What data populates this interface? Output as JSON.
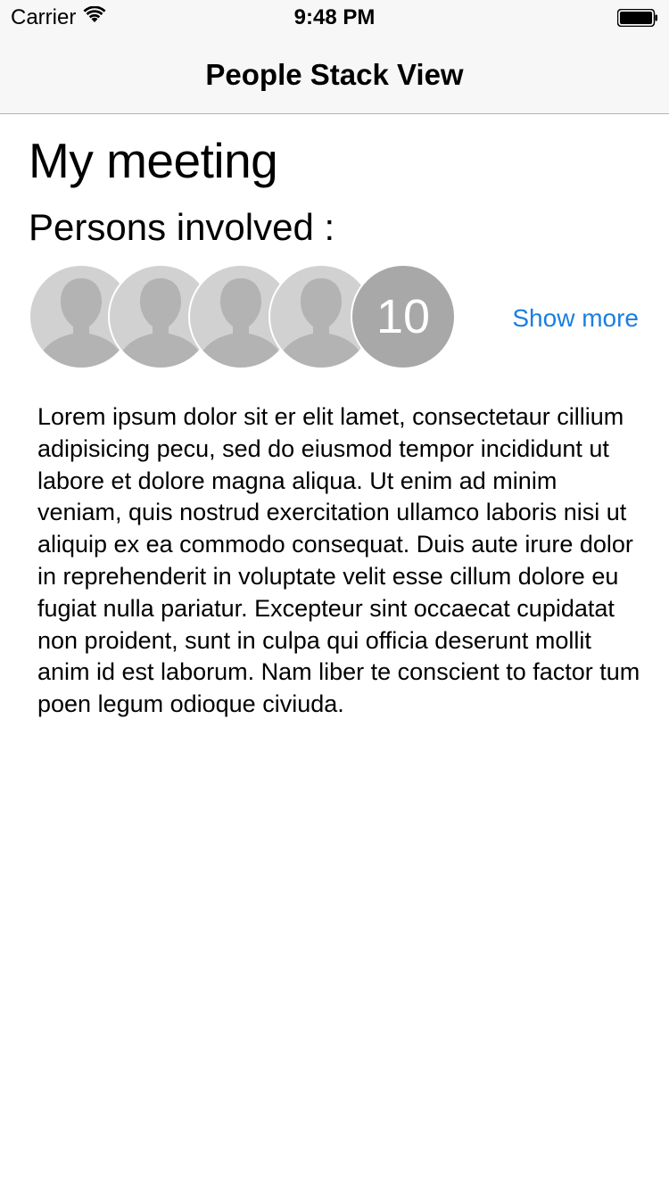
{
  "status_bar": {
    "carrier": "Carrier",
    "time": "9:48 PM",
    "icons": [
      "wifi-icon",
      "battery-icon"
    ]
  },
  "nav": {
    "title": "People Stack View"
  },
  "main": {
    "title": "My meeting",
    "subtitle": "Persons involved :",
    "avatars": [
      "avatar-placeholder",
      "avatar-placeholder",
      "avatar-placeholder",
      "avatar-placeholder"
    ],
    "more_count": "10",
    "show_more_label": "Show more",
    "description": "Lorem ipsum dolor sit er elit lamet, consectetaur cillium adipisicing pecu, sed do eiusmod tempor incididunt ut labore et dolore magna aliqua. Ut enim ad minim veniam, quis nostrud exercitation ullamco laboris nisi ut aliquip ex ea commodo consequat. Duis aute irure dolor in reprehenderit in voluptate velit esse cillum dolore eu fugiat nulla pariatur. Excepteur sint occaecat cupidatat non proident, sunt in culpa qui officia deserunt mollit anim id est laborum. Nam liber te conscient to factor tum poen legum odioque civiuda."
  },
  "colors": {
    "accent": "#1a7fe0",
    "nav_background": "#f7f7f7",
    "avatar_background": "#d1d1d1",
    "avatar_silhouette": "#b3b3b3",
    "count_background": "#a8a8a8"
  }
}
